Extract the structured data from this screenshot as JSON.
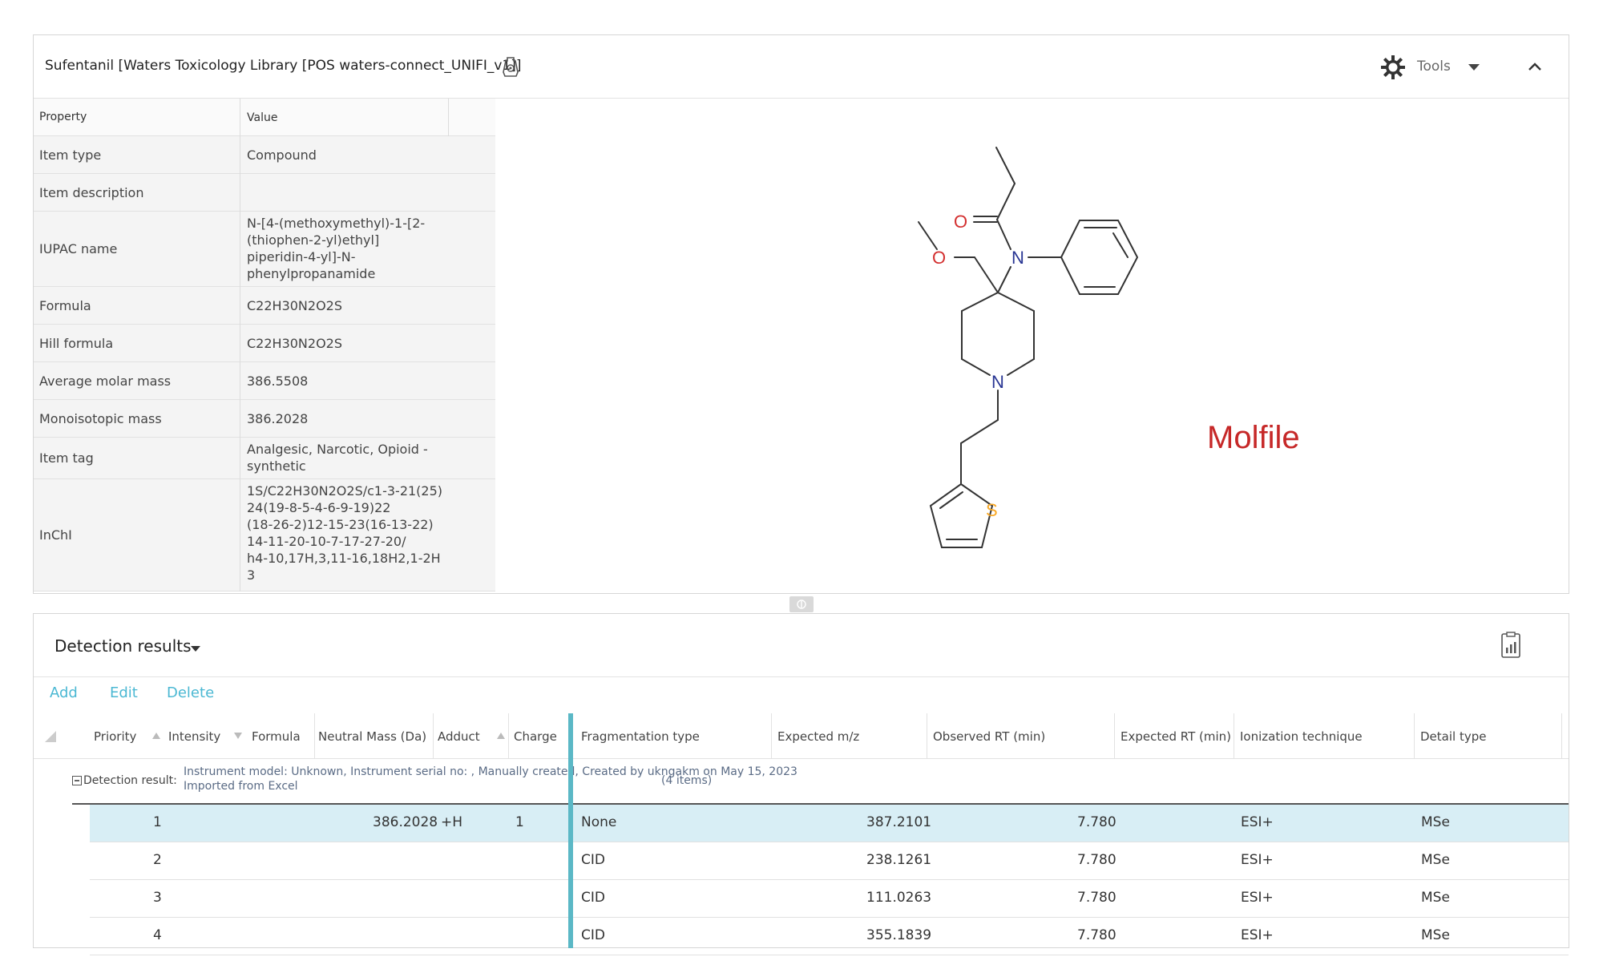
{
  "compound_panel": {
    "title": "Sufentanil  [Waters Toxicology Library [POS waters-connect_UNIFI_v1]]",
    "tools_label": "Tools",
    "properties_header": {
      "property": "Property",
      "value": "Value"
    },
    "properties": [
      {
        "property": "Item type",
        "value": "Compound"
      },
      {
        "property": "Item description",
        "value": ""
      },
      {
        "property": "IUPAC name",
        "value": "N-[4-(methoxymethyl)-1-[2-\n(thiophen-2-yl)ethyl]\npiperidin-4-yl]-N-\nphenylpropanamide"
      },
      {
        "property": "Formula",
        "value": "C22H30N2O2S"
      },
      {
        "property": "Hill formula",
        "value": "C22H30N2O2S"
      },
      {
        "property": "Average molar mass",
        "value": "386.5508"
      },
      {
        "property": "Monoisotopic mass",
        "value": "386.2028"
      },
      {
        "property": "Item tag",
        "value": "Analgesic, Narcotic, Opioid -\nsynthetic"
      },
      {
        "property": "InChI",
        "value": "1S/C22H30N2O2S/c1-3-21(25)\n24(19-8-5-4-6-9-19)22\n(18-26-2)12-15-23(16-13-22)\n14-11-20-10-7-17-27-20/\nh4-10,17H,3,11-16,18H2,1-2H\n3"
      }
    ],
    "structure_atoms": {
      "o1": "O",
      "o2": "O",
      "n1": "N",
      "n2": "N",
      "s": "S"
    },
    "molfile_label": "Molfile"
  },
  "detection_panel": {
    "title": "Detection results",
    "actions": {
      "add": "Add",
      "edit": "Edit",
      "delete": "Delete"
    },
    "columns": {
      "priority": "Priority",
      "intensity": "Intensity",
      "formula": "Formula",
      "neutral_mass": "Neutral Mass (Da)",
      "adduct": "Adduct",
      "charge": "Charge",
      "fragmentation_type": "Fragmentation type",
      "expected_mz": "Expected m/z",
      "observed_rt": "Observed RT (min)",
      "expected_rt": "Expected RT (min)",
      "ionization": "Ionization technique",
      "detail_type": "Detail type"
    },
    "group": {
      "label": "Detection result:",
      "description": "Instrument model: Unknown, Instrument serial no: , Manually created, Created by ukngakm on May 15, 2023\nImported from Excel",
      "count": "(4 items)"
    },
    "rows": [
      {
        "priority": "1",
        "neutral_mass": "386.2028",
        "adduct": "+H",
        "charge": "1",
        "fragmentation_type": "None",
        "expected_mz": "387.2101",
        "expected_rt": "7.780",
        "ionization": "ESI+",
        "detail_type": "MSe",
        "selected": true
      },
      {
        "priority": "2",
        "neutral_mass": "",
        "adduct": "",
        "charge": "",
        "fragmentation_type": "CID",
        "expected_mz": "238.1261",
        "expected_rt": "7.780",
        "ionization": "ESI+",
        "detail_type": "MSe"
      },
      {
        "priority": "3",
        "neutral_mass": "",
        "adduct": "",
        "charge": "",
        "fragmentation_type": "CID",
        "expected_mz": "111.0263",
        "expected_rt": "7.780",
        "ionization": "ESI+",
        "detail_type": "MSe"
      },
      {
        "priority": "4",
        "neutral_mass": "",
        "adduct": "",
        "charge": "",
        "fragmentation_type": "CID",
        "expected_mz": "355.1839",
        "expected_rt": "7.780",
        "ionization": "ESI+",
        "detail_type": "MSe"
      }
    ]
  },
  "colors": {
    "accent": "#5bb8c6",
    "link": "#4bb8d3",
    "selected_row": "#d8eef5",
    "molfile_label": "#c62828",
    "oxygen": "#d32f2f",
    "nitrogen": "#283593",
    "sulfur": "#f9a825"
  },
  "icons": [
    "reagent-icon",
    "gear-icon",
    "chevron-down-icon",
    "chevron-up-icon",
    "resize-handle-icon",
    "export-report-icon",
    "expand-collapse-icon"
  ]
}
